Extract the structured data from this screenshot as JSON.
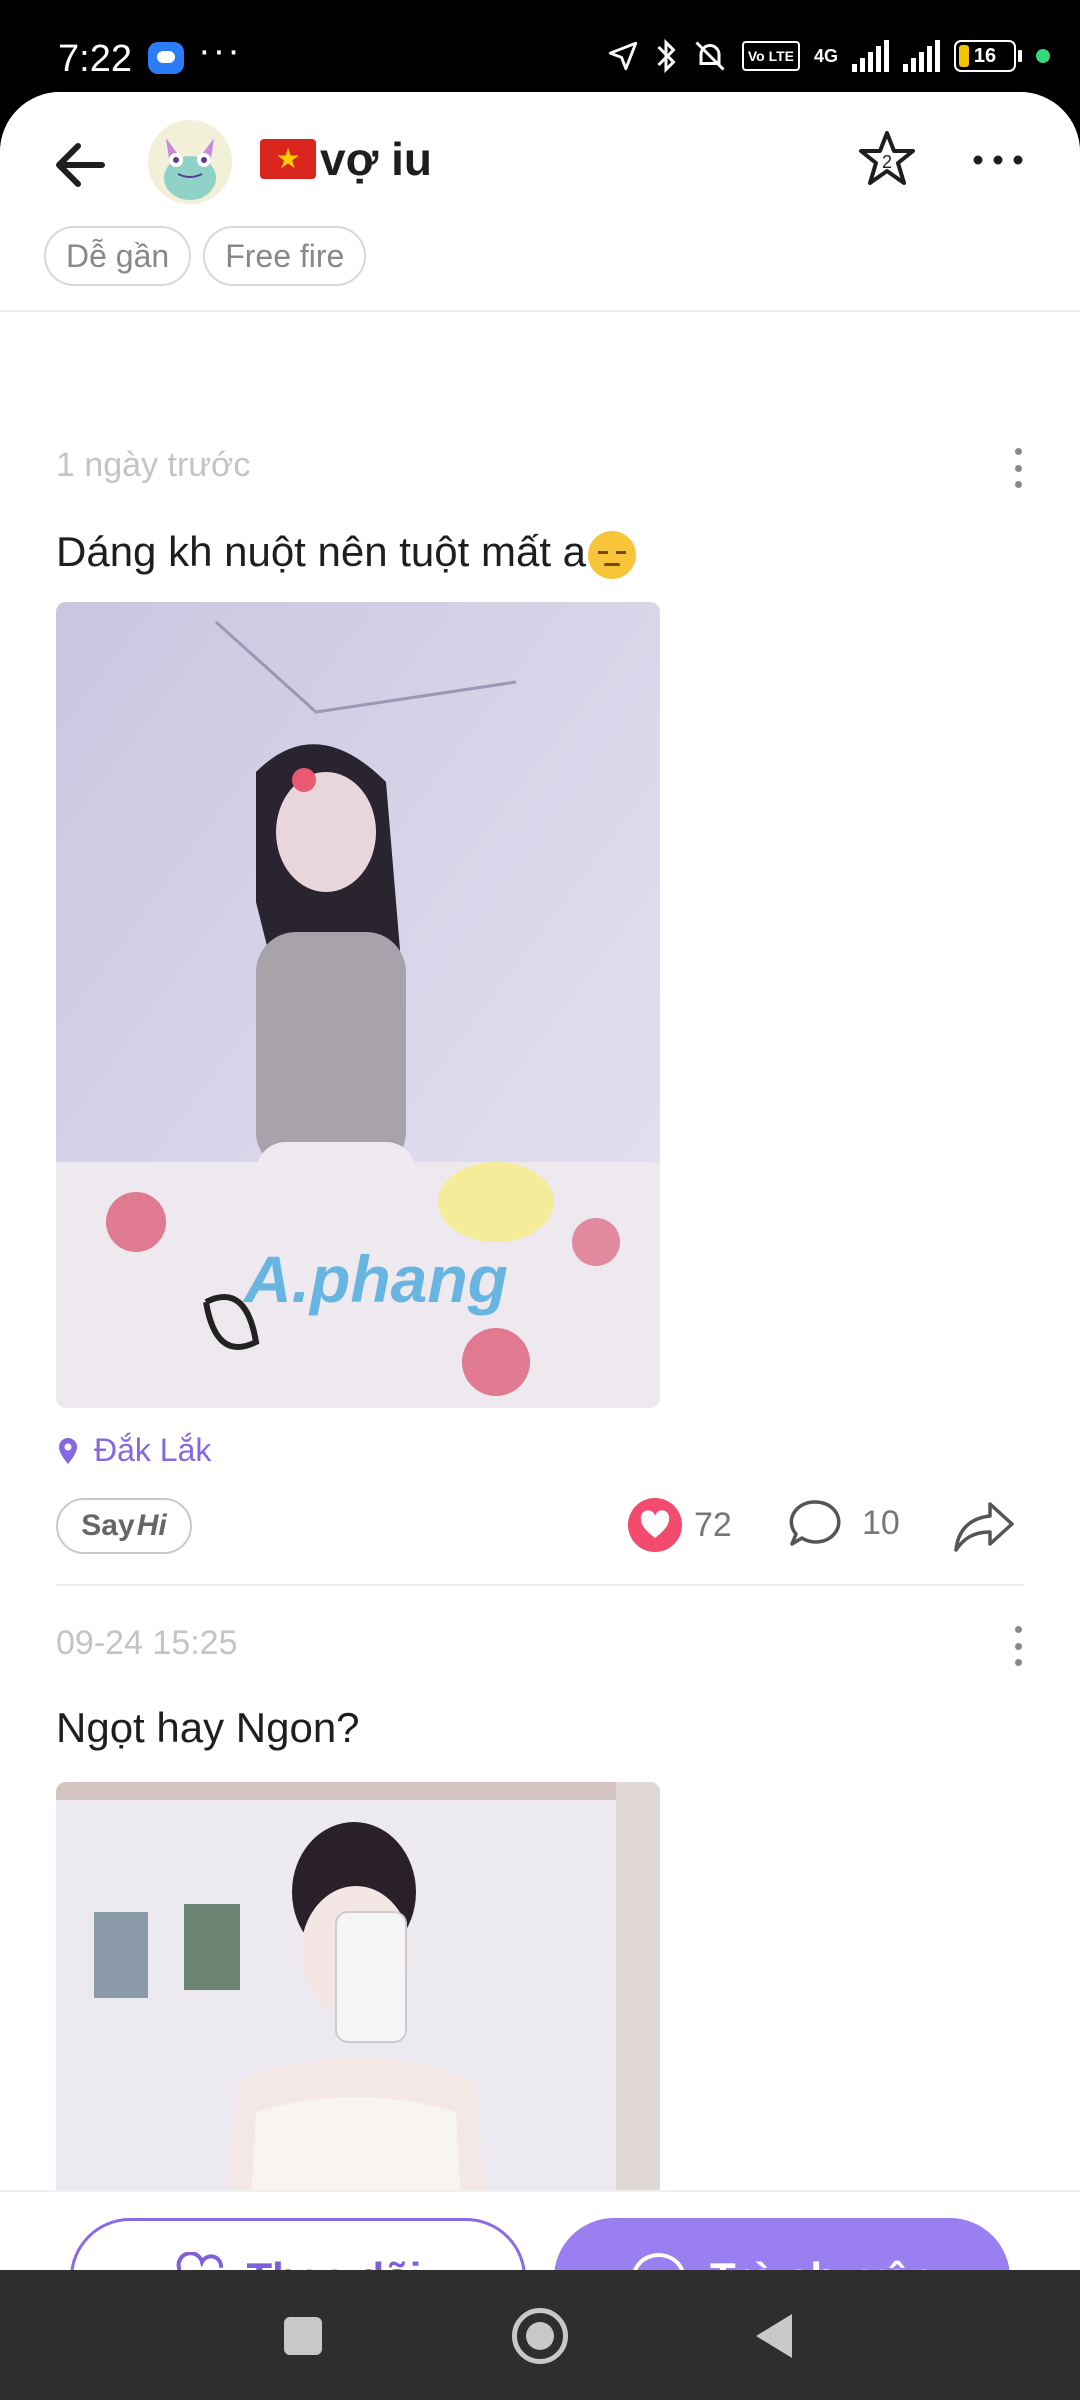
{
  "status_bar": {
    "time": "7:22",
    "dots": "···",
    "volte_label": "Vo LTE",
    "network": "4G",
    "battery": "16"
  },
  "header": {
    "profile_name": "vợ iu"
  },
  "tags": [
    "Dễ gần",
    "Free fire"
  ],
  "posts": [
    {
      "time": "1 ngày trước",
      "text": "Dáng kh nuột nên tuột mất a",
      "watermark": "A.phang",
      "location": "Đắk Lắk",
      "sayhi": {
        "say": "Say",
        "hi": "Hi"
      },
      "likes": "72",
      "comments": "10"
    },
    {
      "time": "09-24 15:25",
      "text": "Ngọt hay Ngon?"
    }
  ],
  "bottom": {
    "follow_label": "Theo dõi",
    "chat_label": "Trò chuyện"
  },
  "colors": {
    "accent": "#9a7ff0",
    "accent_text": "#7f5fe0",
    "like": "#f34b6e"
  }
}
